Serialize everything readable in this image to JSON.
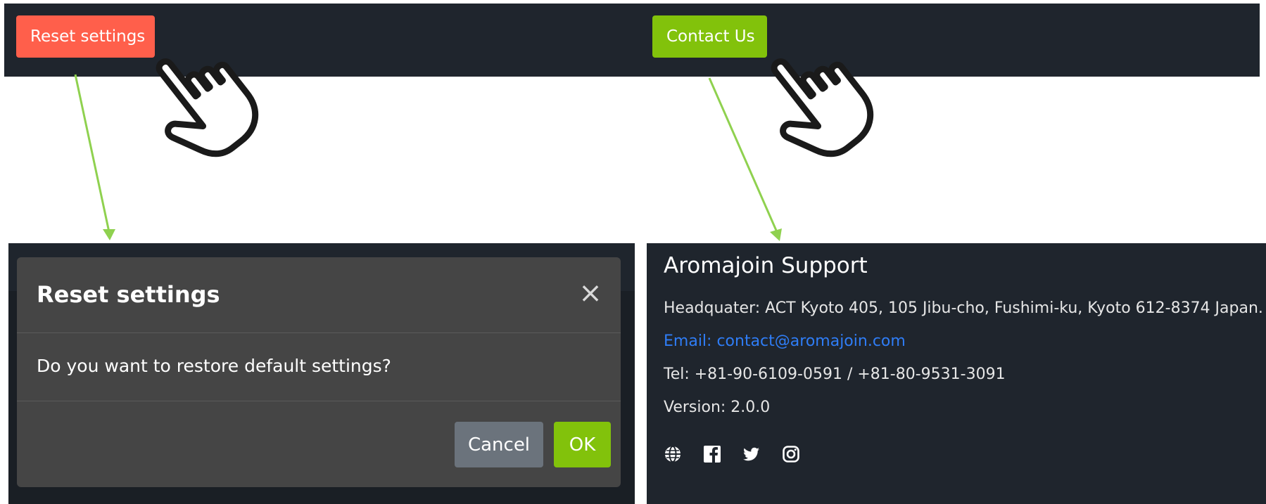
{
  "top_left": {
    "button_label": "Reset settings"
  },
  "top_right": {
    "button_label": "Contact Us"
  },
  "modal": {
    "title": "Reset settings",
    "close_symbol": "×",
    "message": "Do you want to restore default settings?",
    "cancel_label": "Cancel",
    "ok_label": "OK"
  },
  "support": {
    "title": "Aromajoin Support",
    "headquarter": "Headquater: ACT Kyoto 405, 105 Jibu-cho, Fushimi-ku, Kyoto 612-8374 Japan.",
    "email_label": "Email: ",
    "email": "contact@aromajoin.com",
    "tel": "Tel: +81-90-6109-0591 / +81-80-9531-3091",
    "version": "Version: 2.0.0",
    "social_icons": [
      "globe-icon",
      "facebook-icon",
      "twitter-icon",
      "instagram-icon"
    ]
  },
  "colors": {
    "dark_bg": "#1f252d",
    "reset_red": "#ff5f4b",
    "accent_green": "#82c20b",
    "arrow_green": "#8fd14f",
    "link_blue": "#2f7df6",
    "modal_bg": "#454545",
    "cancel_gray": "#6b737c"
  }
}
